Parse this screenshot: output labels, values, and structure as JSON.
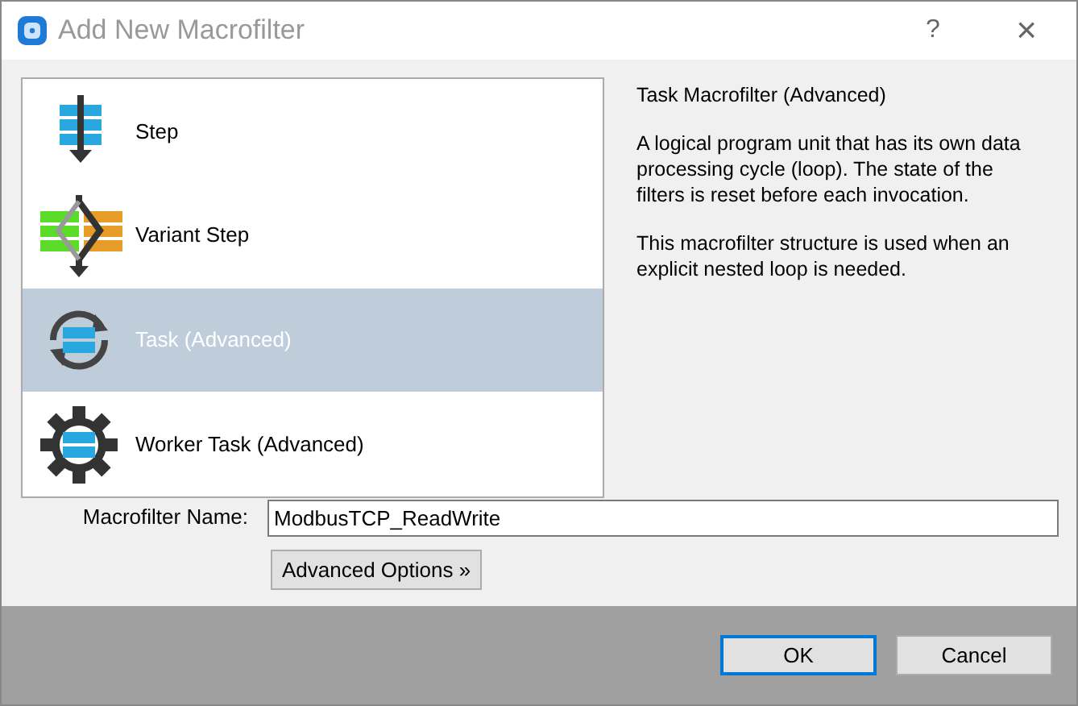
{
  "window": {
    "title": "Add New Macrofilter",
    "help": "?",
    "close": "×"
  },
  "types": [
    {
      "kind": "step",
      "label": "Step",
      "selected": false
    },
    {
      "kind": "variant",
      "label": "Variant Step",
      "selected": false
    },
    {
      "kind": "task",
      "label": "Task (Advanced)",
      "selected": true
    },
    {
      "kind": "worker",
      "label": "Worker Task (Advanced)",
      "selected": false
    }
  ],
  "description": {
    "title": "Task Macrofilter (Advanced)",
    "paragraphs": [
      "A logical program unit that has its own data processing cycle (loop). The state of the filters is reset before each invocation.",
      "This macrofilter structure is used when an explicit nested loop is needed."
    ]
  },
  "name_field": {
    "label": "Macrofilter Name:",
    "value": "ModbusTCP_ReadWrite"
  },
  "advanced_button": "Advanced Options »",
  "buttons": [
    {
      "label": "OK",
      "default": true
    },
    {
      "label": "Cancel",
      "default": false
    }
  ]
}
